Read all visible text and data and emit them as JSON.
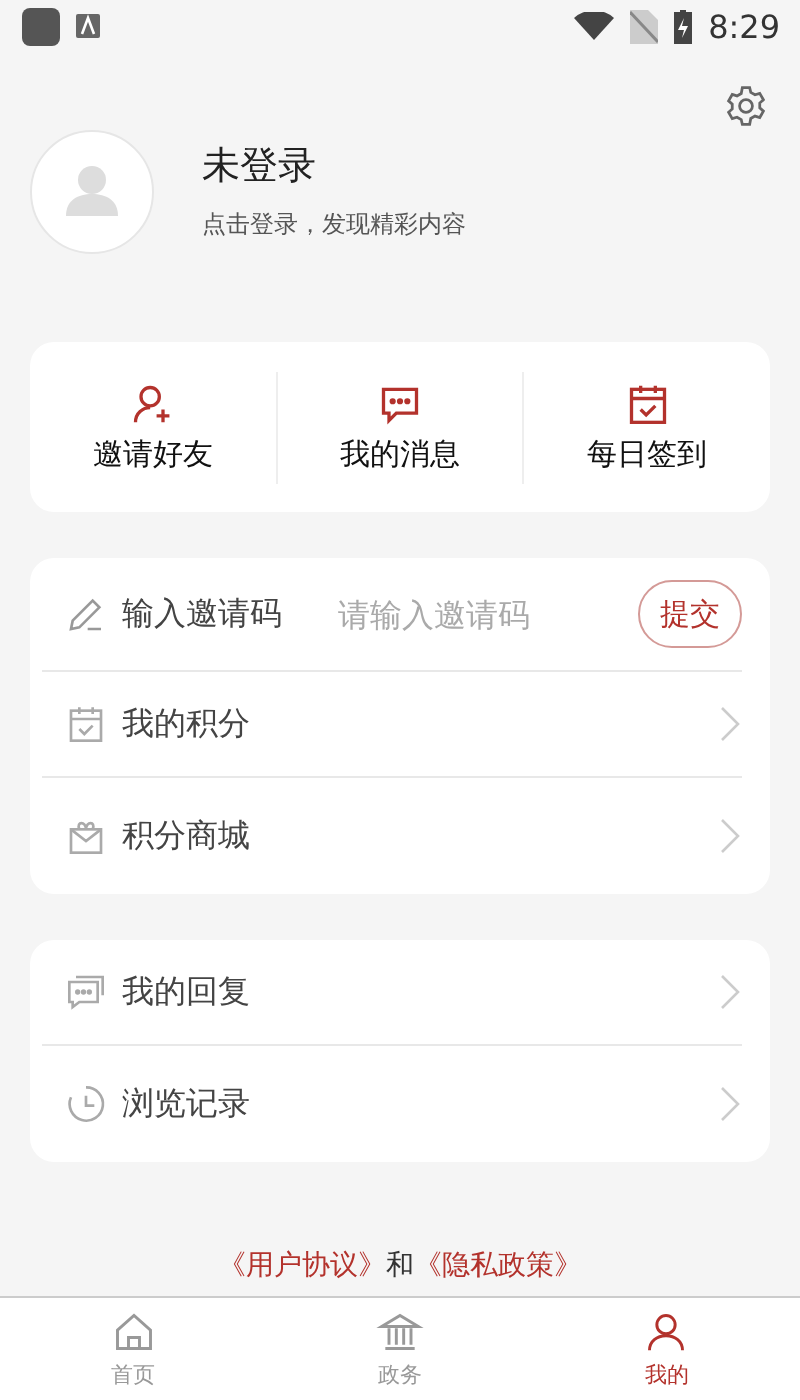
{
  "status_bar": {
    "time": "8:29"
  },
  "profile": {
    "name": "未登录",
    "subtitle": "点击登录，发现精彩内容"
  },
  "quick_actions": [
    {
      "label": "邀请好友",
      "kind": "invite"
    },
    {
      "label": "我的消息",
      "kind": "message"
    },
    {
      "label": "每日签到",
      "kind": "checkin"
    }
  ],
  "invite_code": {
    "label": "输入邀请码",
    "placeholder": "请输入邀请码",
    "button": "提交"
  },
  "menu_groups": [
    [
      {
        "label": "我的积分",
        "kind": "points"
      },
      {
        "label": "积分商城",
        "kind": "mall"
      }
    ],
    [
      {
        "label": "我的回复",
        "kind": "reply"
      },
      {
        "label": "浏览记录",
        "kind": "history"
      }
    ]
  ],
  "footer": {
    "agreement": "《用户协议》",
    "conjunction": "和",
    "privacy": "《隐私政策》"
  },
  "tabs": [
    {
      "label": "首页",
      "kind": "home",
      "selected": false
    },
    {
      "label": "政务",
      "kind": "government",
      "selected": false
    },
    {
      "label": "我的",
      "kind": "me",
      "selected": true
    }
  ]
}
